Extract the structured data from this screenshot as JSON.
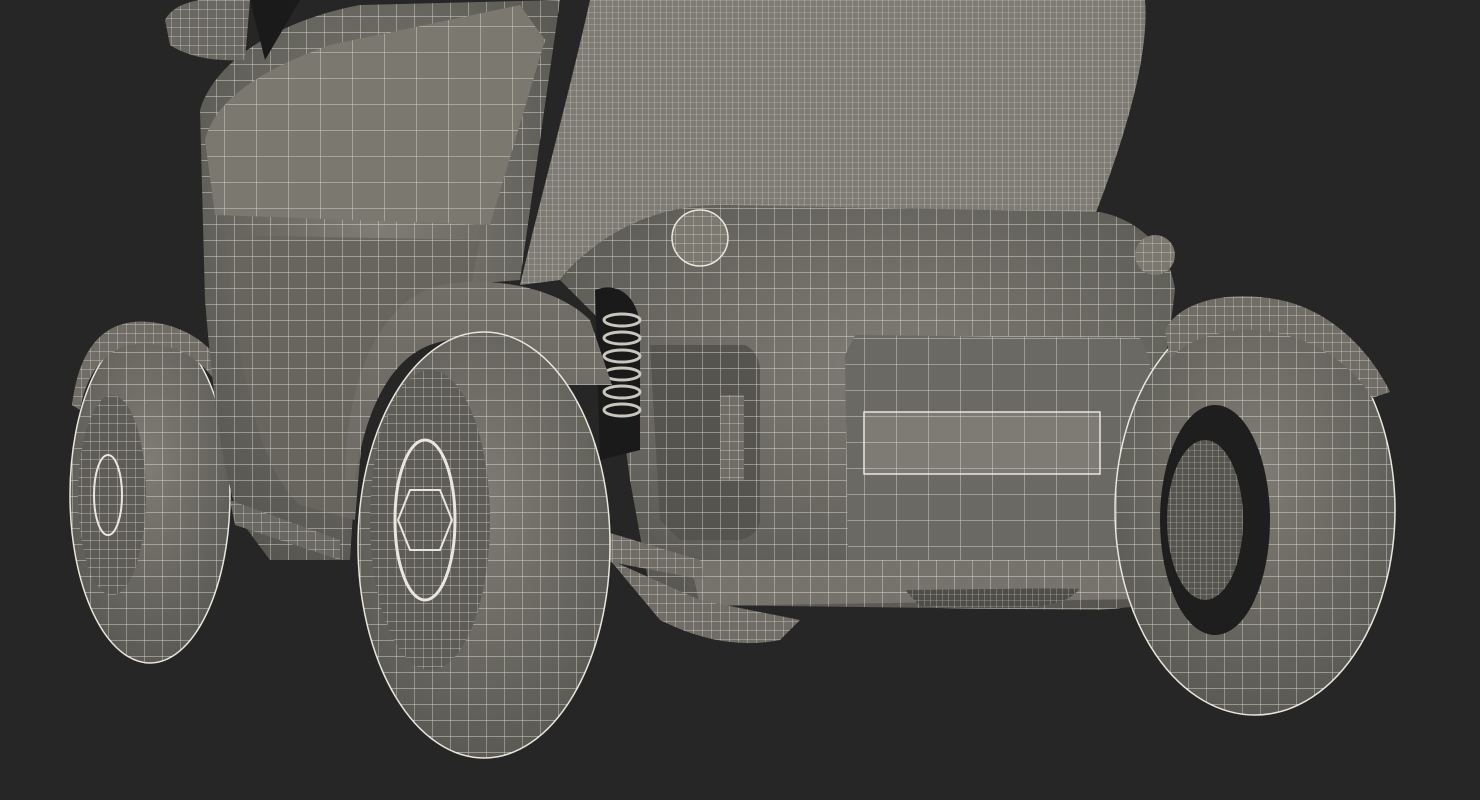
{
  "scene": {
    "subject": "wireframe-render",
    "colors": {
      "background": "#262626",
      "surface": "#6f6d66",
      "surface_light": "#8a8880",
      "surface_dark": "#4e4d48",
      "wire": "#e9e7dd",
      "wire_dim": "#c9c7bd",
      "interior": "#1a1a1a"
    }
  }
}
